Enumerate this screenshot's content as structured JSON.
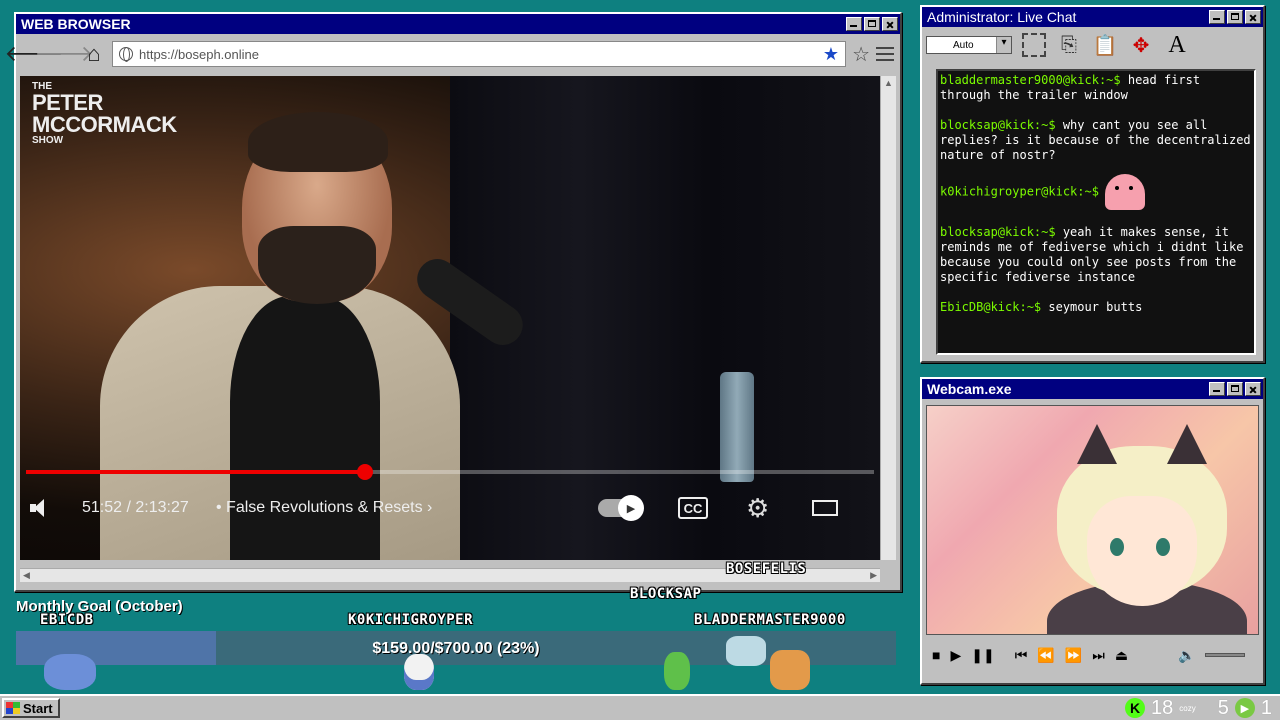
{
  "browser": {
    "title": "WEB BROWSER",
    "url": "https://boseph.online"
  },
  "video": {
    "show_logo": [
      "THE",
      "PETER",
      "MCCORMACK",
      "SHOW"
    ],
    "progress": 0.4,
    "time": "51:52 / 2:13:27",
    "chapter": "• False Revolutions & Resets  ›",
    "cc_label": "CC"
  },
  "chat": {
    "title": "Administrator: Live Chat",
    "font_size": "Auto",
    "messages": [
      {
        "user": "bladdermaster9000@kick:~$",
        "text": " head first through the trailer window"
      },
      {
        "user": "blocksap@kick:~$",
        "text": " why cant you see all replies? is it because of the decentralized nature of nostr?"
      },
      {
        "user": "k0kichigroyper@kick:~$",
        "text": ""
      },
      {
        "user": "blocksap@kick:~$",
        "text": " yeah it makes sense, it reminds me of fediverse which i didnt like because you could only see posts from the specific fediverse instance"
      },
      {
        "user": "EbicDB@kick:~$",
        "text": " seymour butts"
      }
    ]
  },
  "webcam": {
    "title": "Webcam.exe",
    "controls": [
      "stop",
      "play",
      "pause",
      "prev",
      "rewind",
      "forward",
      "next",
      "eject",
      "volume"
    ]
  },
  "overlay": {
    "names": {
      "bosefelis": "BOSEFELIS",
      "blocksap": "BLOCKSAP",
      "ebicdb": "EBICDB",
      "kokichi": "K0KICHIGROYPER",
      "bladder": "BLADDERMASTER9000"
    },
    "goal_title": "Monthly Goal (October)",
    "goal_amount": "$159.00/$700.00 (23%)",
    "goal_fraction": 0.227
  },
  "taskbar": {
    "start": "Start",
    "kick_count": "18",
    "cozy_label": "cozy",
    "viewer_count_a": "5",
    "viewer_count_b": "1"
  }
}
